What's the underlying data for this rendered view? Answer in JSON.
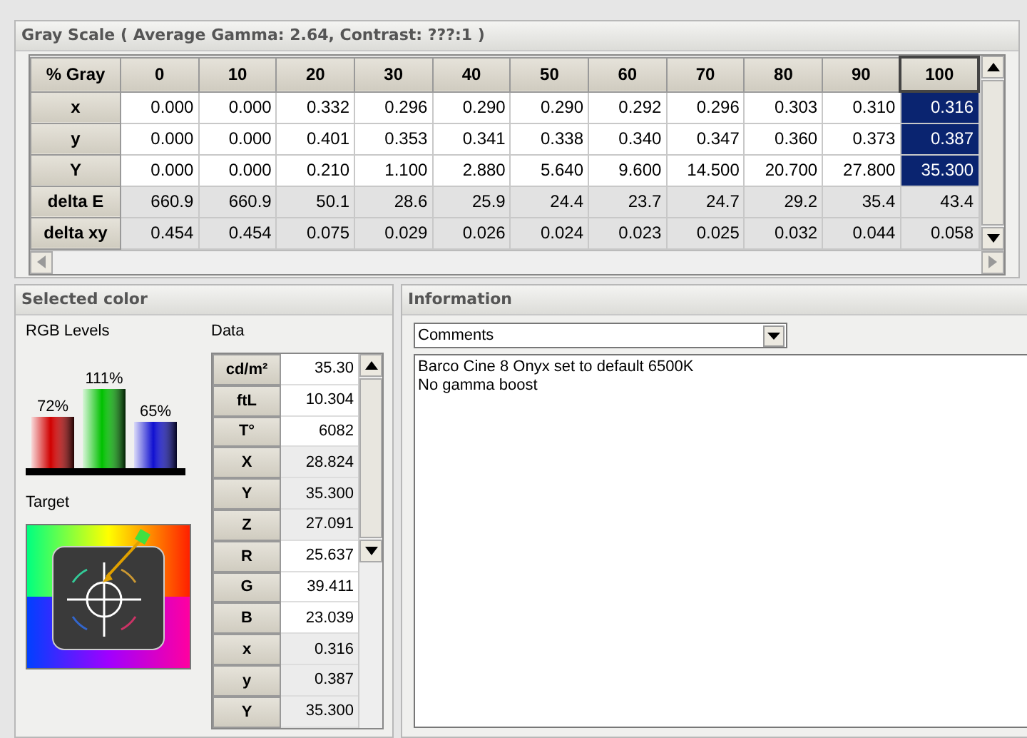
{
  "gray_scale": {
    "title": "Gray Scale ( Average Gamma: 2.64, Contrast: ???:1 )",
    "corner": "% Gray",
    "columns": [
      {
        "label": "0",
        "selected": false
      },
      {
        "label": "10",
        "selected": false
      },
      {
        "label": "20",
        "selected": false
      },
      {
        "label": "30",
        "selected": false
      },
      {
        "label": "40",
        "selected": false
      },
      {
        "label": "50",
        "selected": false
      },
      {
        "label": "60",
        "selected": false
      },
      {
        "label": "70",
        "selected": false
      },
      {
        "label": "80",
        "selected": false
      },
      {
        "label": "90",
        "selected": false
      },
      {
        "label": "100",
        "selected": true
      }
    ],
    "rows": [
      {
        "label": "x",
        "kind": "measured",
        "cells": [
          {
            "value": "0.000",
            "selected": false
          },
          {
            "value": "0.000",
            "selected": false
          },
          {
            "value": "0.332",
            "selected": false
          },
          {
            "value": "0.296",
            "selected": false
          },
          {
            "value": "0.290",
            "selected": false
          },
          {
            "value": "0.290",
            "selected": false
          },
          {
            "value": "0.292",
            "selected": false
          },
          {
            "value": "0.296",
            "selected": false
          },
          {
            "value": "0.303",
            "selected": false
          },
          {
            "value": "0.310",
            "selected": false
          },
          {
            "value": "0.316",
            "selected": true
          }
        ]
      },
      {
        "label": "y",
        "kind": "measured",
        "cells": [
          {
            "value": "0.000",
            "selected": false
          },
          {
            "value": "0.000",
            "selected": false
          },
          {
            "value": "0.401",
            "selected": false
          },
          {
            "value": "0.353",
            "selected": false
          },
          {
            "value": "0.341",
            "selected": false
          },
          {
            "value": "0.338",
            "selected": false
          },
          {
            "value": "0.340",
            "selected": false
          },
          {
            "value": "0.347",
            "selected": false
          },
          {
            "value": "0.360",
            "selected": false
          },
          {
            "value": "0.373",
            "selected": false
          },
          {
            "value": "0.387",
            "selected": true
          }
        ]
      },
      {
        "label": "Y",
        "kind": "measured",
        "cells": [
          {
            "value": "0.000",
            "selected": false
          },
          {
            "value": "0.000",
            "selected": false
          },
          {
            "value": "0.210",
            "selected": false
          },
          {
            "value": "1.100",
            "selected": false
          },
          {
            "value": "2.880",
            "selected": false
          },
          {
            "value": "5.640",
            "selected": false
          },
          {
            "value": "9.600",
            "selected": false
          },
          {
            "value": "14.500",
            "selected": false
          },
          {
            "value": "20.700",
            "selected": false
          },
          {
            "value": "27.800",
            "selected": false
          },
          {
            "value": "35.300",
            "selected": true
          }
        ]
      },
      {
        "label": "delta E",
        "kind": "computed",
        "cells": [
          {
            "value": "660.9",
            "selected": false
          },
          {
            "value": "660.9",
            "selected": false
          },
          {
            "value": "50.1",
            "selected": false
          },
          {
            "value": "28.6",
            "selected": false
          },
          {
            "value": "25.9",
            "selected": false
          },
          {
            "value": "24.4",
            "selected": false
          },
          {
            "value": "23.7",
            "selected": false
          },
          {
            "value": "24.7",
            "selected": false
          },
          {
            "value": "29.2",
            "selected": false
          },
          {
            "value": "35.4",
            "selected": false
          },
          {
            "value": "43.4",
            "selected": false
          }
        ]
      },
      {
        "label": "delta xy",
        "kind": "computed",
        "cells": [
          {
            "value": "0.454",
            "selected": false
          },
          {
            "value": "0.454",
            "selected": false
          },
          {
            "value": "0.075",
            "selected": false
          },
          {
            "value": "0.029",
            "selected": false
          },
          {
            "value": "0.026",
            "selected": false
          },
          {
            "value": "0.024",
            "selected": false
          },
          {
            "value": "0.023",
            "selected": false
          },
          {
            "value": "0.025",
            "selected": false
          },
          {
            "value": "0.032",
            "selected": false
          },
          {
            "value": "0.044",
            "selected": false
          },
          {
            "value": "0.058",
            "selected": false
          }
        ]
      }
    ]
  },
  "selected_color": {
    "title": "Selected color",
    "rgb_label": "RGB Levels",
    "data_label": "Data",
    "target_label": "Target",
    "rgb_levels": {
      "chart_data": {
        "type": "bar",
        "categories": [
          null
        ],
        "series": [
          {
            "color": "#d00000",
            "values": [
              72
            ],
            "value_labels": [
              "72%"
            ]
          },
          {
            "color": "#00c000",
            "values": [
              111
            ],
            "value_labels": [
              "111%"
            ]
          },
          {
            "color": "#1010d0",
            "values": [
              65
            ],
            "value_labels": [
              "65%"
            ]
          }
        ]
      }
    },
    "data": [
      {
        "label": "cd/m²",
        "value": "35.30",
        "kind": "light"
      },
      {
        "label": "ftL",
        "value": "10.304",
        "kind": "light"
      },
      {
        "label": "T°",
        "value": "6082",
        "kind": "light"
      },
      {
        "label": "X",
        "value": "28.824",
        "kind": "shaded"
      },
      {
        "label": "Y",
        "value": "35.300",
        "kind": "shaded"
      },
      {
        "label": "Z",
        "value": "27.091",
        "kind": "shaded"
      },
      {
        "label": "R",
        "value": "25.637",
        "kind": "light"
      },
      {
        "label": "G",
        "value": "39.411",
        "kind": "light"
      },
      {
        "label": "B",
        "value": "23.039",
        "kind": "light"
      },
      {
        "label": "x",
        "value": "0.316",
        "kind": "shaded"
      },
      {
        "label": "y",
        "value": "0.387",
        "kind": "shaded"
      },
      {
        "label": "Y",
        "value": "35.300",
        "kind": "shaded"
      }
    ]
  },
  "information": {
    "title": "Information",
    "dropdown": "Comments",
    "comments": [
      "Barco Cine 8 Onyx set to default 6500K",
      "No gamma boost"
    ]
  }
}
